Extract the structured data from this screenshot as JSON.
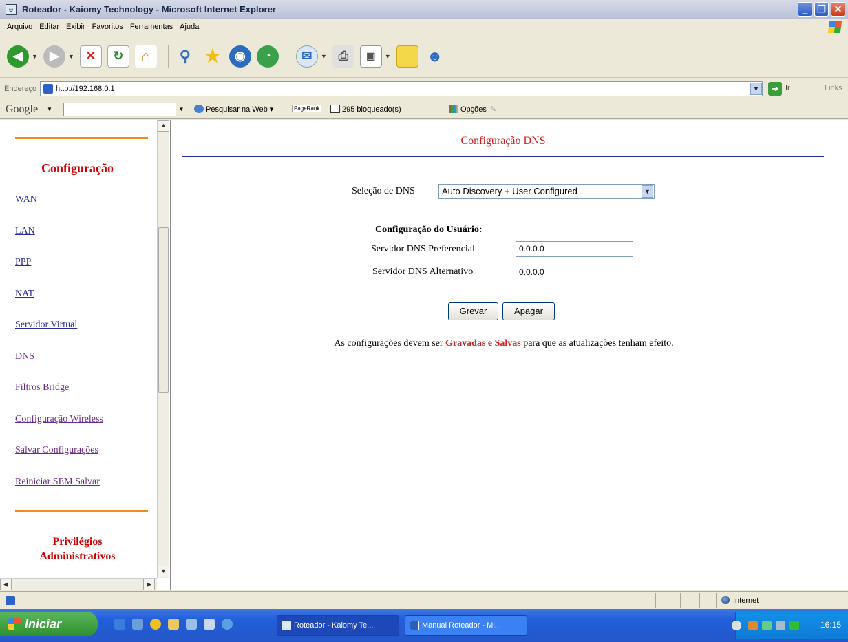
{
  "window": {
    "title": "Roteador - Kaiomy Technology - Microsoft Internet Explorer"
  },
  "menu": [
    "Arquivo",
    "Editar",
    "Exibir",
    "Favoritos",
    "Ferramentas",
    "Ajuda"
  ],
  "address_bar": {
    "label": "Endereço",
    "url": "http://192.168.0.1",
    "go_label": "Ir",
    "links_label": "Links"
  },
  "google_toolbar": {
    "logo": "Google",
    "search_web": "Pesquisar na Web",
    "pagerank": "PageRank",
    "blocked": "295 bloqueado(s)",
    "options": "Opções"
  },
  "sidebar": {
    "section1_title": "Configuração",
    "links": [
      "WAN",
      "LAN",
      "PPP",
      "NAT",
      "Servidor Virtual",
      "DNS",
      "Filtros Bridge",
      "Configuração Wireless",
      "Salvar Configurações",
      "Reiniciar SEM Salvar"
    ],
    "section2_title_line1": "Privilégios",
    "section2_title_line2": "Administrativos"
  },
  "main": {
    "title": "Configuração DNS",
    "dns_selection_label": "Seleção de DNS",
    "dns_selection_value": "Auto Discovery + User Configured",
    "user_config_label": "Configuração do Usuário:",
    "preferred_label": "Servidor DNS Preferencial",
    "preferred_value": "0.0.0.0",
    "alternate_label": "Servidor DNS Alternativo",
    "alternate_value": "0.0.0.0",
    "save_button": "Grevar",
    "clear_button": "Apagar",
    "note_before": "As configurações devem ser ",
    "note_emphasis": "Gravadas e Salvas",
    "note_after": " para que as atualizações tenham efeito."
  },
  "status_bar": {
    "zone": "Internet"
  },
  "taskbar": {
    "start_label": "Iniciar",
    "tasks": [
      "Roteador - Kaiomy Te...",
      "Manual Roteador - Mi..."
    ],
    "clock": "16:15"
  },
  "colors": {
    "accent_red": "#cc2222",
    "rule_blue": "#1f2fa8",
    "rule_orange": "#f08a20",
    "link": "#2a2a9a"
  }
}
